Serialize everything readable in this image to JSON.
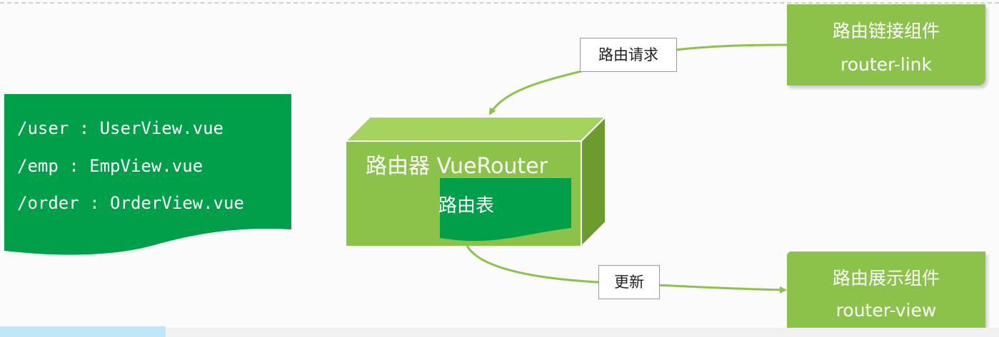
{
  "routes": [
    "/user : UserView.vue",
    "/emp : EmpView.vue",
    "/order : OrderView.vue"
  ],
  "router": {
    "title": "路由器 VueRouter",
    "table_label": "路由表"
  },
  "link_component": {
    "title": "路由链接组件",
    "name": "router-link"
  },
  "view_component": {
    "title": "路由展示组件",
    "name": "router-view"
  },
  "edges": {
    "request_label": "路由请求",
    "update_label": "更新"
  },
  "colors": {
    "dark_green": "#00a04a",
    "light_green": "#8bc34a",
    "cube_top": "#a5d45e",
    "cube_side": "#6d9c2e",
    "arrow": "#8bc34a"
  }
}
